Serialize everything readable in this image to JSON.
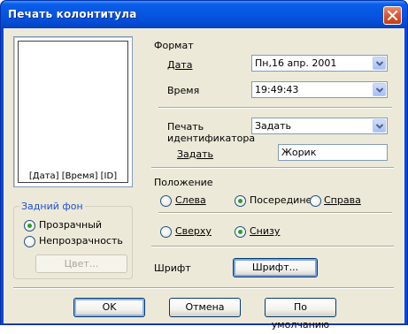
{
  "window": {
    "title": "Печать колонтитула"
  },
  "preview": {
    "text": "[Дата] [Время] [ID]"
  },
  "background_group": {
    "caption": "Задний фон",
    "options": [
      {
        "label": "Прозрачный",
        "selected": true
      },
      {
        "label": "Непрозрачность",
        "selected": false
      }
    ],
    "color_button": "Цвет..."
  },
  "format": {
    "heading": "Формат",
    "date_label": "Дата",
    "date_value": "Пн,16 апр. 2001",
    "time_label": "Время",
    "time_value": "19:49:43",
    "id_label_line1": "Печать",
    "id_label_line2": "идентификатора",
    "id_value": "Задать",
    "set_label": "Задать",
    "set_value": "Жорик"
  },
  "position": {
    "heading": "Положение",
    "horizontal": [
      {
        "label": "Слева",
        "selected": false
      },
      {
        "label": "Посередине",
        "selected": true
      },
      {
        "label": "Справа",
        "selected": false
      }
    ],
    "vertical": [
      {
        "label": "Сверху",
        "selected": false
      },
      {
        "label": "Снизу",
        "selected": true
      }
    ]
  },
  "font": {
    "label": "Шрифт",
    "button": "Шрифт..."
  },
  "buttons": {
    "ok": "OK",
    "cancel": "Отмена",
    "default": "По умолчанию"
  }
}
